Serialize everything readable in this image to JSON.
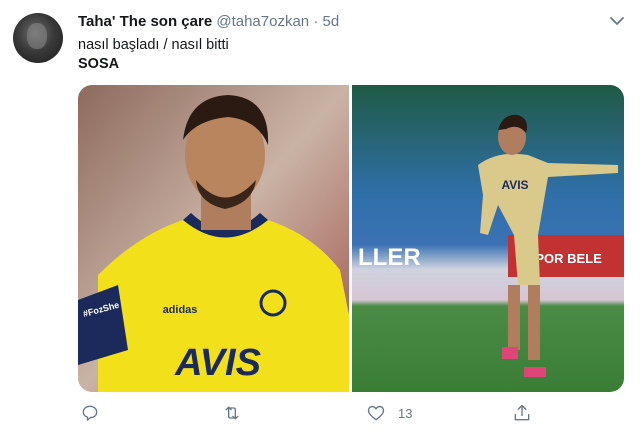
{
  "tweet": {
    "author_name": "Taha' The son çare",
    "handle": "@taha7ozkan",
    "separator": "·",
    "time": "5d",
    "line1": "nasıl başladı / nasıl bitti",
    "line2": "SOSA"
  },
  "media": {
    "left_photo": {
      "shirt_text": "AVIS",
      "brand_text": "adidas",
      "armband_text": "#FozShe"
    },
    "right_photo": {
      "shirt_text": "AVIS",
      "banner_text_left": "LLER",
      "banner_text_right": "ESPOR BELE"
    }
  },
  "actions": {
    "reply_icon": "reply-icon",
    "retweet_icon": "retweet-icon",
    "like_icon": "heart-icon",
    "like_count": "13",
    "share_icon": "share-icon"
  },
  "colors": {
    "text_primary": "#14171a",
    "text_secondary": "#657786",
    "fenerbahce_yellow": "#f2e01a",
    "fenerbahce_navy": "#1b2a5a",
    "pitch_green": "#3f8a3e"
  }
}
